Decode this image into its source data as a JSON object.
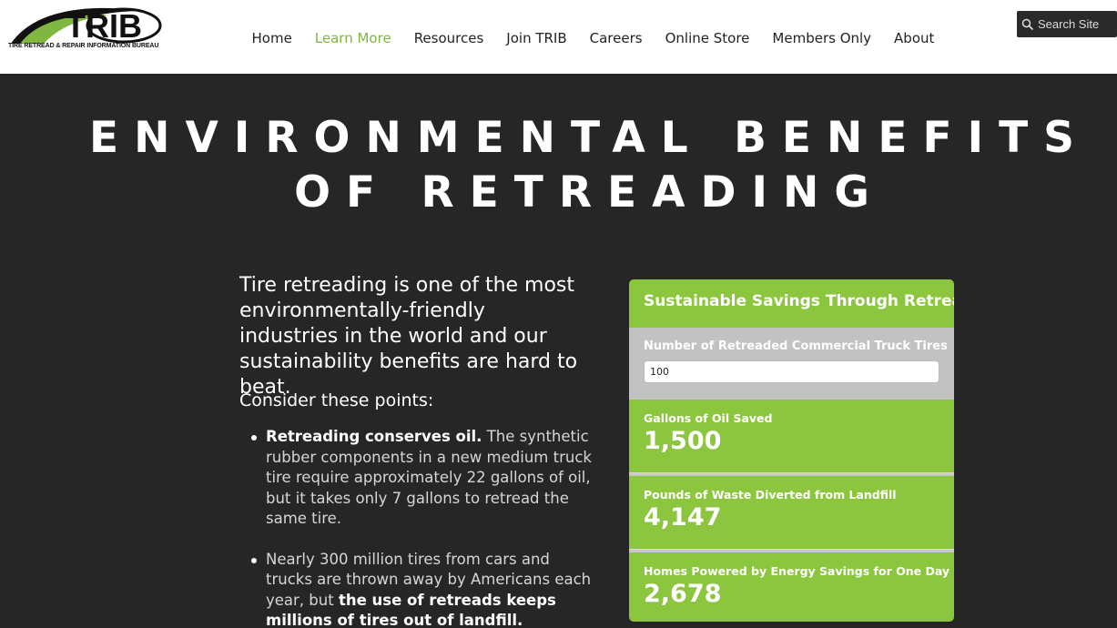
{
  "header": {
    "logo_text": "TRIB",
    "logo_subtitle": "TIRE RETREAD & REPAIR INFORMATION BUREAU",
    "nav": [
      {
        "label": "Home",
        "active": false
      },
      {
        "label": "Learn More",
        "active": true
      },
      {
        "label": "Resources",
        "active": false
      },
      {
        "label": "Join TRIB",
        "active": false
      },
      {
        "label": "Careers",
        "active": false
      },
      {
        "label": "Online Store",
        "active": false
      },
      {
        "label": "Members Only",
        "active": false
      },
      {
        "label": "About",
        "active": false
      }
    ],
    "search_label": "Search Site",
    "search_icon": "search-icon",
    "accent_color": "#7fb741"
  },
  "page": {
    "title_line1": "ENVIRONMENTAL BENEFITS",
    "title_line2": "OF RETREADING",
    "intro": "Tire retreading is one of the most environmentally-friendly industries in the world and our sustainability benefits are hard to beat.",
    "consider": "Consider these points:",
    "points": [
      {
        "bold_lead": "Retreading conserves oil.",
        "text": " The synthetic rubber components in a new medium truck tire require approximately 22 gallons of oil, but it takes only 7 gallons to retread the same tire."
      },
      {
        "text": "Nearly 300 million tires from cars and trucks are thrown away by Americans each year, but ",
        "bold_tail": "the use of retreads keeps millions of tires out of landfill."
      }
    ]
  },
  "calculator": {
    "title": "Sustainable Savings Through Retreading",
    "input_label": "Number of Retreaded Commercial Truck Tires",
    "input_value": "100",
    "green_color": "#8cc63f",
    "stats": [
      {
        "label": "Gallons of Oil Saved",
        "value": "1,500"
      },
      {
        "label": "Pounds of Waste Diverted from Landfill",
        "value": "4,147"
      },
      {
        "label": "Homes Powered by Energy Savings for One Day",
        "value": "2,678"
      }
    ]
  }
}
